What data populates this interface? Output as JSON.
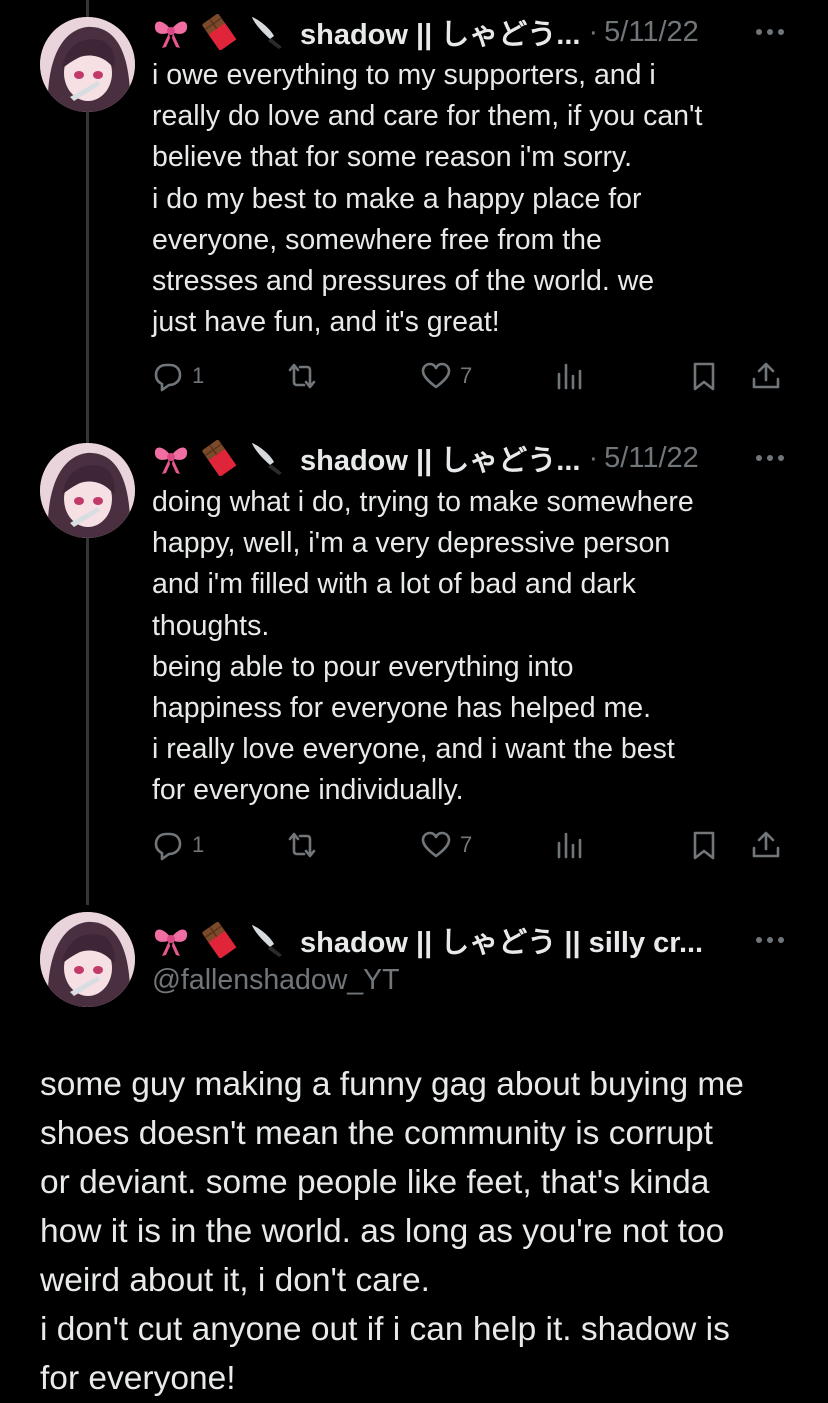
{
  "posts": [
    {
      "author": {
        "emoji_icons": [
          "ribbon-icon",
          "chocolate-bar-icon",
          "knife-icon"
        ],
        "display_name": "shadow || しゃどう...",
        "date": "5/11/22"
      },
      "text": "i owe everything to my supporters, and i\nreally do love and care for them, if you can't\nbelieve that for some reason i'm sorry.\ni do my best to make a happy place for\neveryone, somewhere free from the\nstresses and pressures of the world. we\njust have fun, and it's great!",
      "actions": {
        "replies": "1",
        "retweets": "",
        "likes": "7"
      }
    },
    {
      "author": {
        "emoji_icons": [
          "ribbon-icon",
          "chocolate-bar-icon",
          "knife-icon"
        ],
        "display_name": "shadow || しゃどう...",
        "date": "5/11/22"
      },
      "text": "doing what i do, trying to make somewhere\nhappy, well, i'm a very depressive person\nand i'm filled with a lot of bad and dark\nthoughts.\nbeing able to pour everything into\nhappiness for everyone has helped me.\ni really love everyone, and i want the best\nfor everyone individually.",
      "actions": {
        "replies": "1",
        "retweets": "",
        "likes": "7"
      }
    }
  ],
  "main_post": {
    "author": {
      "emoji_icons": [
        "ribbon-icon",
        "chocolate-bar-icon",
        "knife-icon"
      ],
      "display_name": "shadow || しゃどう || silly cr...",
      "handle": "@fallenshadow_YT"
    },
    "text": "some guy making a funny gag about buying me\nshoes doesn't mean the community is corrupt\nor deviant. some people like feet, that's kinda\nhow it is in the world. as long as you're not too\nweird about it, i don't care.\ni don't cut anyone out if i can help it. shadow is\nfor everyone!"
  },
  "colors": {
    "background": "#000000",
    "text": "#e7e9ea",
    "muted": "#71767b",
    "thread_line": "#333639"
  }
}
